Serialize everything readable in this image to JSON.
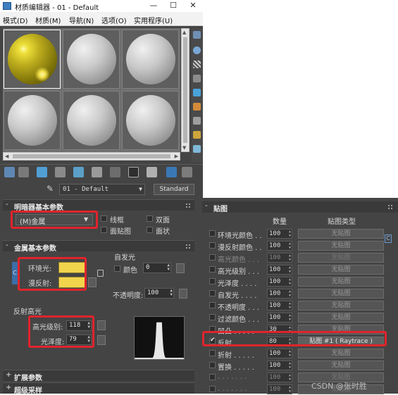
{
  "window": {
    "title": "材质编辑器 - 01 - Default",
    "min_glyph": "—",
    "max_glyph": "☐",
    "close_glyph": "✕"
  },
  "menu": [
    {
      "label": "模式(D)"
    },
    {
      "label": "材质(M)"
    },
    {
      "label": "导航(N)"
    },
    {
      "label": "选项(O)"
    },
    {
      "label": "实用程序(U)"
    }
  ],
  "slots": {
    "count": 6,
    "active_index": 0,
    "active_color": "#efe13b"
  },
  "material": {
    "name": "01 - Default",
    "type": "Standard",
    "dropdown_glyph": "▼",
    "eyedropper_glyph": "✎"
  },
  "shader_basic": {
    "title": "明暗器基本参数",
    "sign": "-",
    "shader": "(M)金属",
    "dropdown_glyph": "▼",
    "options": [
      {
        "label": "线框",
        "checked": false
      },
      {
        "label": "双面",
        "checked": false
      },
      {
        "label": "面贴图",
        "checked": false
      },
      {
        "label": "面状",
        "checked": false
      }
    ]
  },
  "metal_basic": {
    "title": "金属基本参数",
    "sign": "-",
    "ambient_label": "环境光:",
    "diffuse_label": "漫反射:",
    "ambient_color": "#f2d34c",
    "diffuse_color": "#f2d34c",
    "lock_marker": "C",
    "self_illum": {
      "title": "自发光",
      "color_label": "颜色",
      "value": "0"
    },
    "opacity_label": "不透明度:",
    "opacity_value": "100"
  },
  "spec_highlight": {
    "title": "反射高光",
    "level_label": "高光级别:",
    "level_value": "118",
    "gloss_label": "光泽度:",
    "gloss_value": "79"
  },
  "rollouts_collapsed": [
    {
      "label": "扩展参数",
      "sign": "+"
    },
    {
      "label": "超级采样",
      "sign": "+"
    }
  ],
  "maps": {
    "title": "贴图",
    "sign": "-",
    "col_amount": "数量",
    "col_type": "贴图类型",
    "side_marker": "C",
    "rows": [
      {
        "name": "环境光颜色 . .",
        "amount": "100",
        "map": "无贴图",
        "checked": false,
        "dim": false
      },
      {
        "name": "漫反射颜色 . .",
        "amount": "100",
        "map": "无贴图",
        "checked": false,
        "dim": false
      },
      {
        "name": "高光颜色 . . .",
        "amount": "100",
        "map": "无贴图",
        "checked": false,
        "dim": true
      },
      {
        "name": "高光级别 . . .",
        "amount": "100",
        "map": "无贴图",
        "checked": false,
        "dim": false
      },
      {
        "name": "光泽度 . . . .",
        "amount": "100",
        "map": "无贴图",
        "checked": false,
        "dim": false
      },
      {
        "name": "自发光 . . . .",
        "amount": "100",
        "map": "无贴图",
        "checked": false,
        "dim": false
      },
      {
        "name": "不透明度 . . .",
        "amount": "100",
        "map": "无贴图",
        "checked": false,
        "dim": false
      },
      {
        "name": "过滤颜色 . . .",
        "amount": "100",
        "map": "无贴图",
        "checked": false,
        "dim": false
      },
      {
        "name": "凹凸 . . . . .",
        "amount": "30",
        "map": "无贴图",
        "checked": false,
        "dim": false
      },
      {
        "name": "反射 . . . . .",
        "amount": "80",
        "map": "贴图 #1 ( Raytrace )",
        "checked": true,
        "dim": false
      },
      {
        "name": "折射 . . . . .",
        "amount": "100",
        "map": "无贴图",
        "checked": false,
        "dim": false
      },
      {
        "name": "置换 . . . . .",
        "amount": "100",
        "map": "无贴图",
        "checked": false,
        "dim": false
      },
      {
        "name": ". . . . . . .",
        "amount": "100",
        "map": "无贴图",
        "checked": false,
        "dim": true
      },
      {
        "name": ". . . . . . .",
        "amount": "100",
        "map": "无贴图",
        "checked": false,
        "dim": true
      }
    ]
  },
  "watermark": "CSDN @张时胜",
  "accent_red": "#e0242c"
}
